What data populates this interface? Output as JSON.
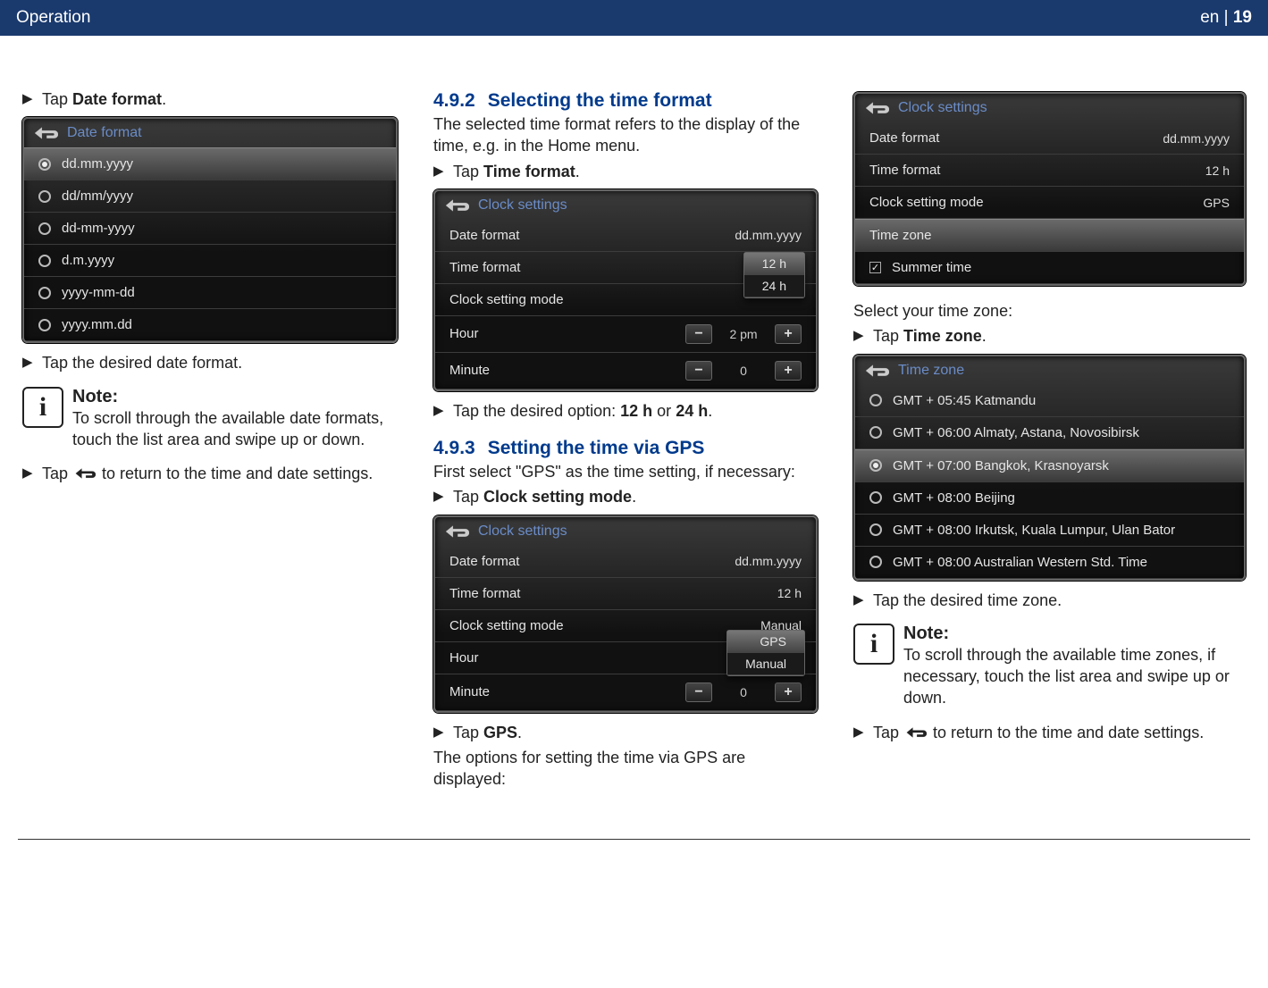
{
  "header": {
    "section": "Operation",
    "lang": "en",
    "page_no": "19"
  },
  "col1": {
    "s1_pre": "Tap ",
    "s1_bold": "Date format",
    "s1_post": ".",
    "fig1": {
      "title": "Date format",
      "opts": [
        "dd.mm.yyyy",
        "dd/mm/yyyy",
        "dd-mm-yyyy",
        "d.m.yyyy",
        "yyyy-mm-dd",
        "yyyy.mm.dd"
      ],
      "selected_idx": 0
    },
    "s2": "Tap the desired date format.",
    "note_title": "Note:",
    "note_text": "To scroll through the available date formats, touch the list area and swipe up or down.",
    "s3_pre": "Tap ",
    "s3_post": " to return to the time and date settings."
  },
  "col2": {
    "h492_num": "4.9.2",
    "h492_title": "Selecting the time format",
    "h492_intro": "The selected time format refers to the display of the time, e.g. in the Home menu.",
    "s_tf_pre": "Tap ",
    "s_tf_bold": "Time format",
    "s_tf_post": ".",
    "fig2": {
      "title": "Clock settings",
      "rows": [
        {
          "label": "Date format",
          "value": "dd.mm.yyyy"
        },
        {
          "label": "Time format",
          "value": "12 h"
        },
        {
          "label": "Clock setting mode",
          "value": ""
        }
      ],
      "dropdown": {
        "opts": [
          "12 h",
          "24 h"
        ],
        "selected_idx": 0
      },
      "hour": {
        "label": "Hour",
        "value": "2 pm"
      },
      "minute": {
        "label": "Minute",
        "value": "0"
      }
    },
    "s_tf2_pre": "Tap the desired option: ",
    "s_tf2_bold1": "12 h",
    "s_tf2_mid": " or ",
    "s_tf2_bold2": "24 h",
    "s_tf2_post": ".",
    "h493_num": "4.9.3",
    "h493_title": "Setting the time via GPS",
    "h493_intro": "First select \"GPS\" as the time setting, if necessary:",
    "s_csm_pre": "Tap ",
    "s_csm_bold": "Clock setting mode",
    "s_csm_post": ".",
    "fig3": {
      "title": "Clock settings",
      "rows": [
        {
          "label": "Date format",
          "value": "dd.mm.yyyy"
        },
        {
          "label": "Time format",
          "value": "12 h"
        },
        {
          "label": "Clock setting mode",
          "value": "Manual"
        }
      ],
      "dropdown": {
        "opts": [
          "GPS",
          "Manual"
        ],
        "selected_idx": 0
      },
      "hour": {
        "label": "Hour",
        "value": ""
      },
      "minute": {
        "label": "Minute",
        "value": "0"
      }
    },
    "s_gps_pre": "Tap ",
    "s_gps_bold": "GPS",
    "s_gps_post": ".",
    "s_gps_after": "The options for setting the time via GPS are displayed:"
  },
  "col3": {
    "fig4": {
      "title": "Clock settings",
      "rows": [
        {
          "label": "Date format",
          "value": "dd.mm.yyyy"
        },
        {
          "label": "Time format",
          "value": "12 h"
        },
        {
          "label": "Clock setting mode",
          "value": "GPS"
        },
        {
          "label": "Time zone",
          "value": ""
        }
      ],
      "summer": "Summer time"
    },
    "tz_intro": "Select your time zone:",
    "s_tz_pre": "Tap ",
    "s_tz_bold": "Time zone",
    "s_tz_post": ".",
    "fig5": {
      "title": "Time zone",
      "opts": [
        "GMT + 05:45 Katmandu",
        "GMT + 06:00 Almaty, Astana, Novosibirsk",
        "GMT + 07:00 Bangkok, Krasnoyarsk",
        "GMT + 08:00 Beijing",
        "GMT + 08:00 Irkutsk, Kuala Lumpur, Ulan Bator",
        "GMT + 08:00 Australian Western Std. Time"
      ],
      "selected_idx": 2
    },
    "s_tz2": "Tap the desired time zone.",
    "note_title": "Note:",
    "note_text": "To scroll through the available time zones, if necessary, touch the list area and swipe up or down.",
    "s_back_pre": "Tap ",
    "s_back_post": " to return to the time and date settings."
  }
}
